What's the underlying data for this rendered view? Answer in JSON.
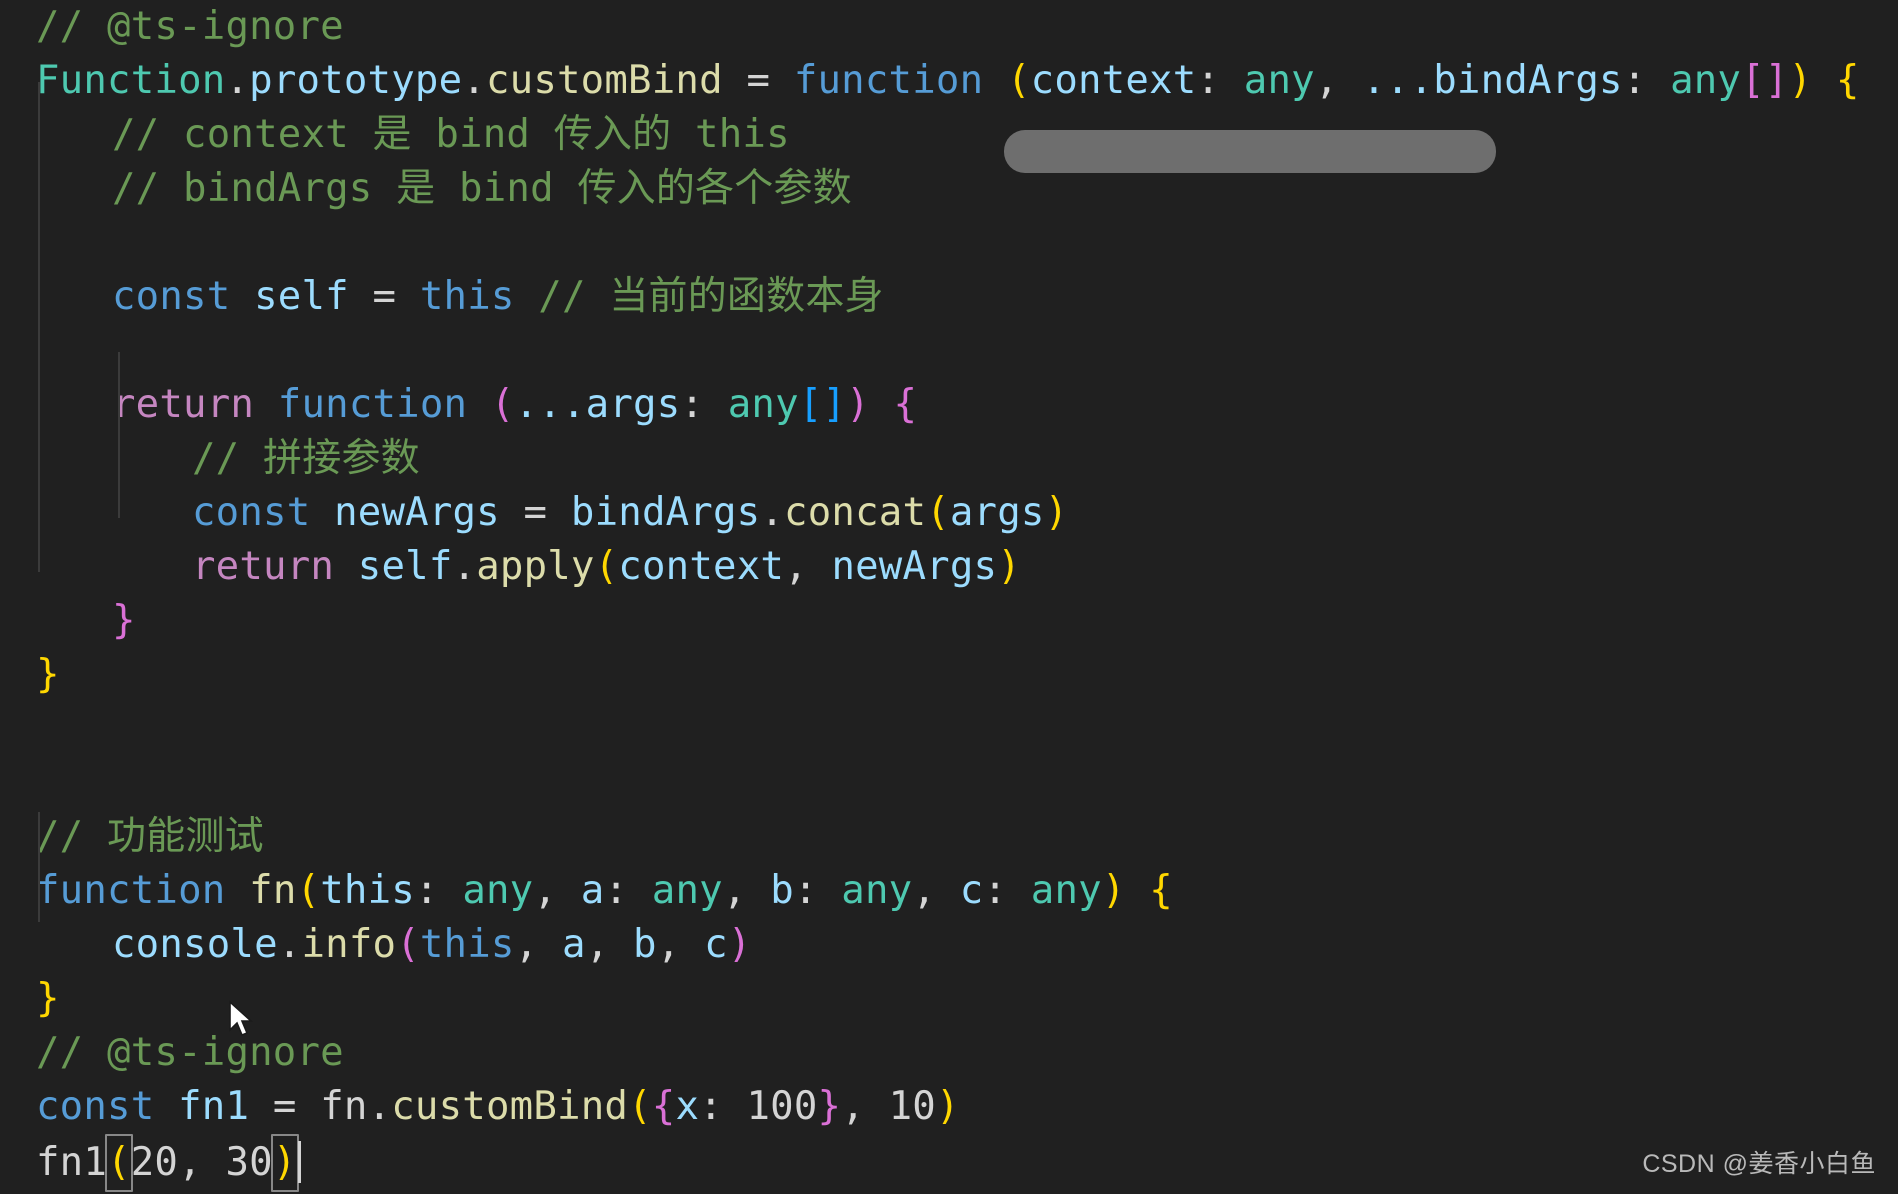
{
  "editor": {
    "background": "#202020",
    "language": "TypeScript",
    "watermark": "CSDN @姜香小白鱼",
    "redaction_label": "redacted-overlay",
    "cursor_icon": "mouse-pointer-icon"
  },
  "colors": {
    "comment": "#6a9955",
    "keyword": "#569cd6",
    "control_keyword": "#c586c0",
    "type": "#4ec9b0",
    "variable": "#9cdcfe",
    "function": "#dcdcaa",
    "plain": "#d4d4d4",
    "bracket_yellow": "#ffd700",
    "bracket_pink": "#da70d6",
    "bracket_blue": "#179fff"
  },
  "code": {
    "lines": [
      {
        "id": "l1",
        "text": "// @ts-ignore"
      },
      {
        "id": "l2",
        "text": "Function.prototype.customBind = function (context: any, ...bindArgs: any[]) {"
      },
      {
        "id": "l3",
        "text": "    // context 是 bind 传入的 this"
      },
      {
        "id": "l4",
        "text": "    // bindArgs 是 bind 传入的各个参数"
      },
      {
        "id": "l5",
        "text": ""
      },
      {
        "id": "l6",
        "text": "    const self = this // 当前的函数本身"
      },
      {
        "id": "l7",
        "text": ""
      },
      {
        "id": "l8",
        "text": "    return function (...args: any[]) {"
      },
      {
        "id": "l9",
        "text": "        // 拼接参数"
      },
      {
        "id": "l10",
        "text": "        const newArgs = bindArgs.concat(args)"
      },
      {
        "id": "l11",
        "text": "        return self.apply(context, newArgs)"
      },
      {
        "id": "l12",
        "text": "    }"
      },
      {
        "id": "l13",
        "text": "}"
      },
      {
        "id": "l14",
        "text": ""
      },
      {
        "id": "l15",
        "text": ""
      },
      {
        "id": "l16",
        "text": "// 功能测试"
      },
      {
        "id": "l17",
        "text": "function fn(this: any, a: any, b: any, c: any) {"
      },
      {
        "id": "l18",
        "text": "    console.info(this, a, b, c)"
      },
      {
        "id": "l19",
        "text": "}"
      },
      {
        "id": "l20",
        "text": "// @ts-ignore"
      },
      {
        "id": "l21",
        "text": "const fn1 = fn.customBind({x: 100}, 10)"
      },
      {
        "id": "l22",
        "text": "fn1(20, 30)"
      }
    ],
    "tokens": {
      "l1": {
        "comment": "// @ts-ignore"
      },
      "l2": {
        "obj": "Function",
        "prop": "prototype",
        "method": "customBind",
        "eq": "=",
        "kw": "function",
        "p1": "context",
        "t1": "any",
        "spread": "...bindArgs",
        "t2": "any",
        "arr": "[]"
      },
      "l3": {
        "comment": "// context 是 bind 传入的 this"
      },
      "l4": {
        "comment": "// bindArgs 是 bind 传入的各个参数"
      },
      "l6": {
        "kw": "const",
        "name": "self",
        "eq": "=",
        "val": "this",
        "comment": "// 当前的函数本身"
      },
      "l8": {
        "kw": "return",
        "kw2": "function",
        "args": "...args",
        "t": "any",
        "arr": "[]"
      },
      "l9": {
        "comment": "// 拼接参数"
      },
      "l10": {
        "kw": "const",
        "name": "newArgs",
        "src": "bindArgs",
        "method": "concat",
        "arg": "args"
      },
      "l11": {
        "kw": "return",
        "obj": "self",
        "method": "apply",
        "a1": "context",
        "a2": "newArgs"
      },
      "l16": {
        "comment": "// 功能测试"
      },
      "l17": {
        "kw": "function",
        "name": "fn",
        "p0": "this",
        "t0": "any",
        "p1": "a",
        "t1": "any",
        "p2": "b",
        "t2": "any",
        "p3": "c",
        "t3": "any"
      },
      "l18": {
        "obj": "console",
        "method": "info",
        "a0": "this",
        "a1": "a",
        "a2": "b",
        "a3": "c"
      },
      "l20": {
        "comment": "// @ts-ignore"
      },
      "l21": {
        "kw": "const",
        "name": "fn1",
        "obj": "fn",
        "method": "customBind",
        "key": "x",
        "num1": "100",
        "num2": "10"
      },
      "l22": {
        "name": "fn1",
        "num1": "20",
        "num2": "30"
      }
    }
  }
}
